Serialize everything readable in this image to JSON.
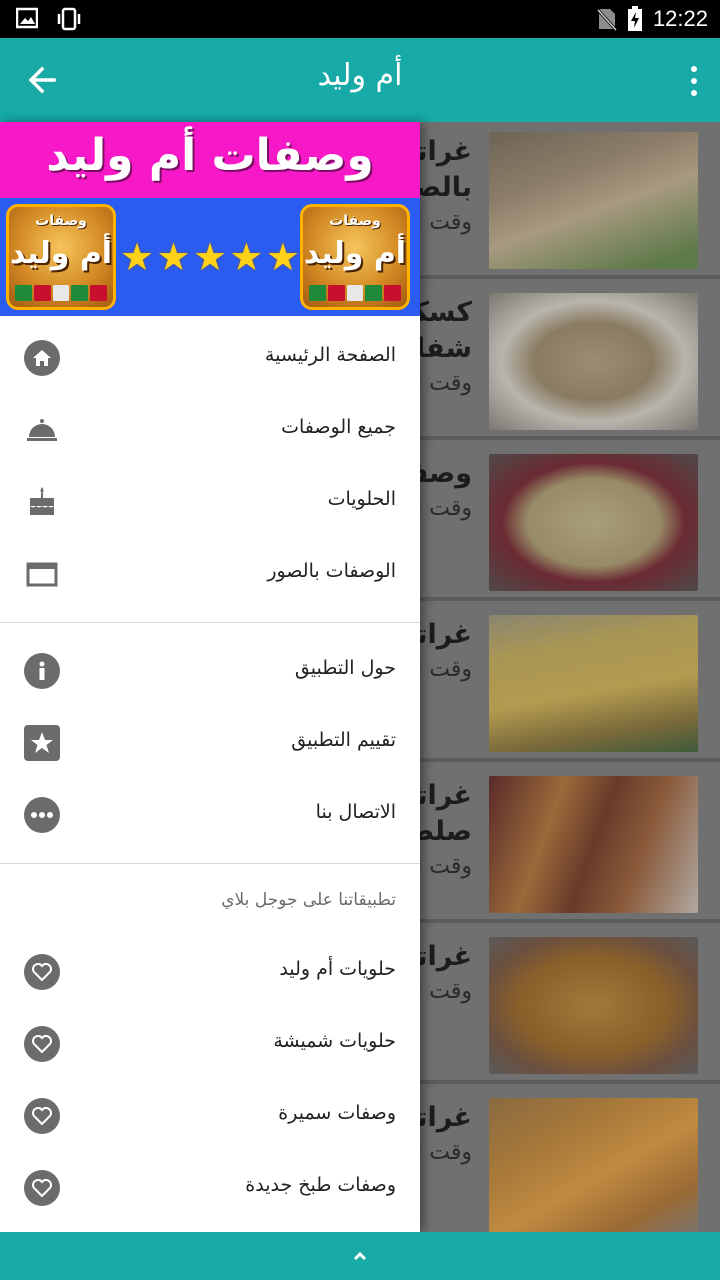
{
  "status_bar": {
    "time": "12:22"
  },
  "app_bar": {
    "title": "أم وليد"
  },
  "recipes": [
    {
      "title_line1": "غراتان",
      "title_line2": "بالصا",
      "time": "وقت ال",
      "colors": [
        "#c9b49a",
        "#8d7a5e",
        "#e7d8b8"
      ]
    },
    {
      "title_line1": "كسكس",
      "title_line2": "شفلو",
      "time": "وقت ال",
      "colors": [
        "#d9c7a3",
        "#b79a6a",
        "#f4f0e6"
      ]
    },
    {
      "title_line1": "وصف",
      "title_line2": "",
      "time": "وقت ال",
      "colors": [
        "#e9d69a",
        "#c9a65a",
        "#a5283a"
      ]
    },
    {
      "title_line1": "غراتا",
      "title_line2": "",
      "time": "وقت ال",
      "colors": [
        "#e6c56a",
        "#b98c33",
        "#7a5a2a"
      ]
    },
    {
      "title_line1": "غراتا",
      "title_line2": "صلص",
      "time": "وقت ال",
      "colors": [
        "#d79b45",
        "#9e3a2a",
        "#e4c08a"
      ]
    },
    {
      "title_line1": "غراتا",
      "title_line2": "",
      "time": "وقت ا",
      "colors": [
        "#e3b347",
        "#b07a2a",
        "#f2d27a"
      ]
    },
    {
      "title_line1": "غراتا",
      "title_line2": "",
      "time": "وقت ا",
      "colors": [
        "#e9a63a",
        "#c46a1e",
        "#f4d78a"
      ]
    }
  ],
  "drawer": {
    "banner_title": "وصفات أم وليد",
    "logo_line1": "وصفات",
    "logo_line2": "أم وليد",
    "stars": [
      "★",
      "★",
      "★",
      "★",
      "★"
    ],
    "main_items": [
      {
        "label": "الصفحة الرئيسية",
        "icon": "home-icon"
      },
      {
        "label": "جميع الوصفات",
        "icon": "cloche-icon"
      },
      {
        "label": "الحلويات",
        "icon": "cake-icon"
      },
      {
        "label": "الوصفات بالصور",
        "icon": "picture-icon"
      }
    ],
    "app_items": [
      {
        "label": "حول التطبيق",
        "icon": "info-icon"
      },
      {
        "label": "تقييم التطبيق",
        "icon": "star-icon"
      },
      {
        "label": "الاتصال بنا",
        "icon": "chat-icon"
      }
    ],
    "section_header": "تطبيقاتنا على جوجل بلاي",
    "store_items": [
      {
        "label": "حلويات أم وليد",
        "icon": "heart-icon"
      },
      {
        "label": "حلويات شميشة",
        "icon": "heart-icon"
      },
      {
        "label": "وصفات سميرة",
        "icon": "heart-icon"
      },
      {
        "label": "وصفات طبخ جديدة",
        "icon": "heart-icon"
      }
    ]
  },
  "colors": {
    "primary": "#17aaa6",
    "banner_pink": "#f719c8",
    "banner_blue": "#2a5cf2",
    "icon_gray": "#6b6b6b"
  }
}
